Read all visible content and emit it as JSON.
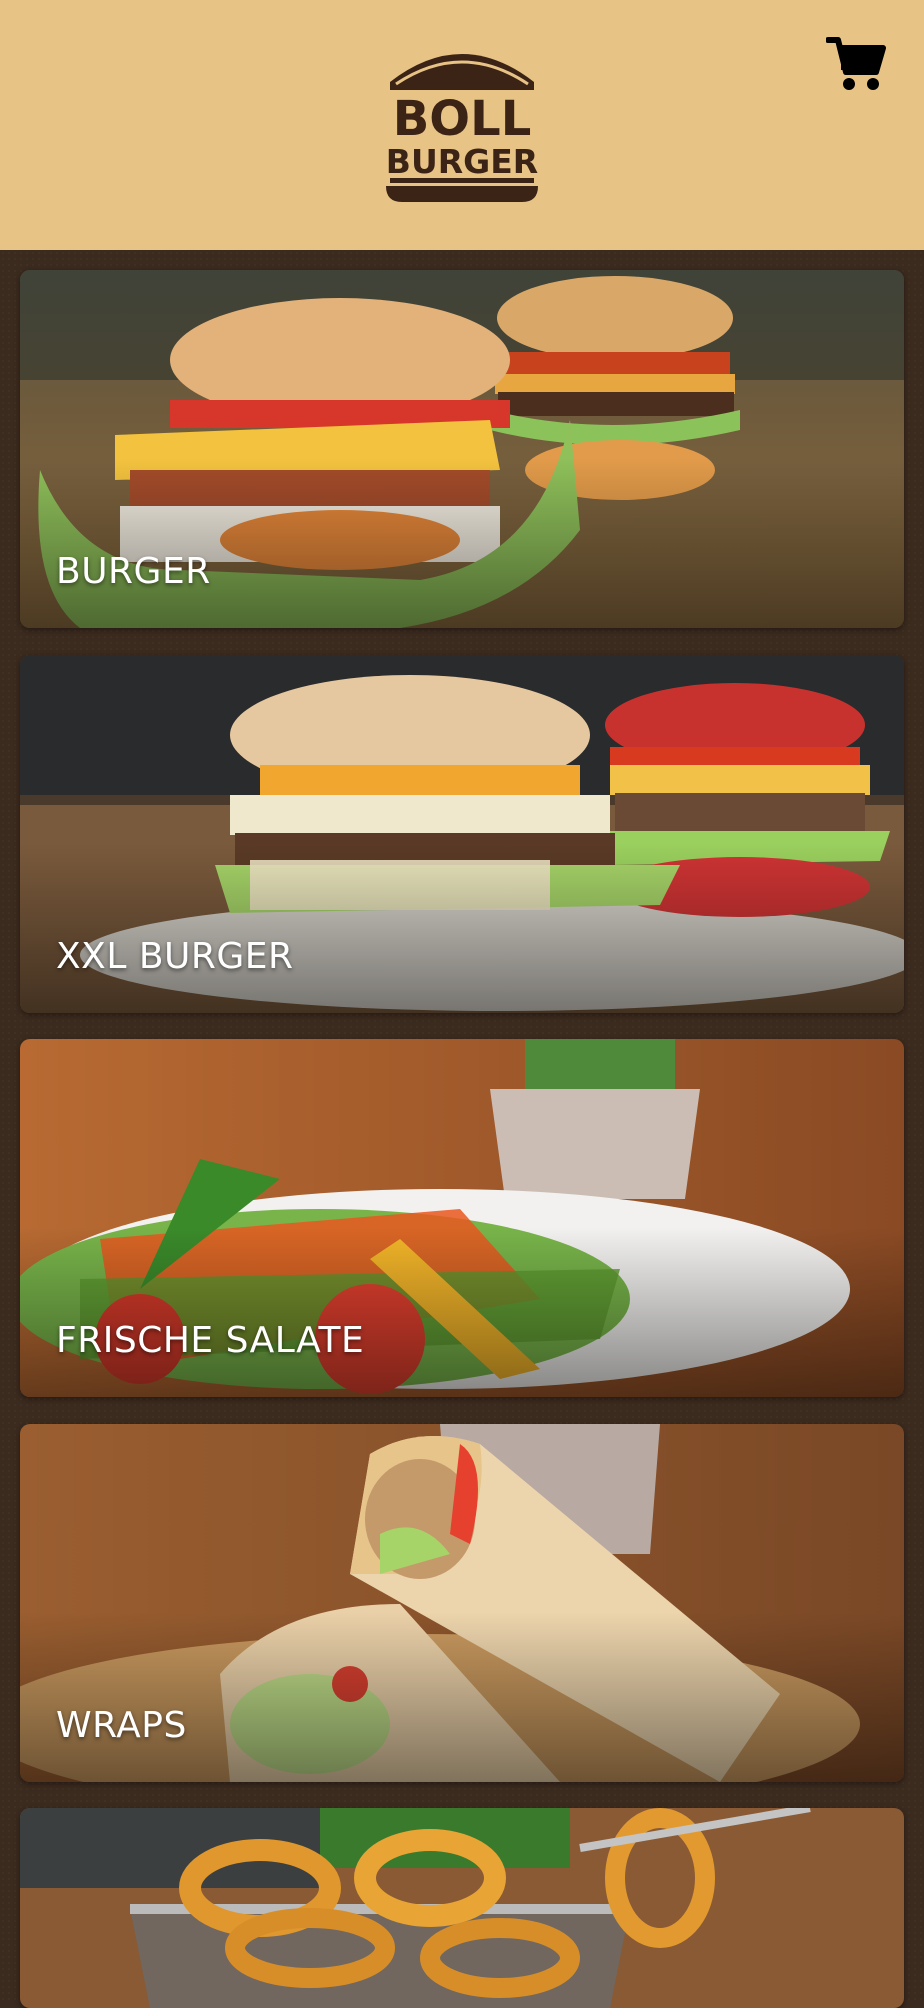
{
  "header": {
    "brand_line1": "BOLL",
    "brand_line2": "BURGER",
    "cart_icon": "shopping-cart-icon",
    "background_color": "#e8c386",
    "brand_color": "#3b2416"
  },
  "categories": [
    {
      "label": "BURGER",
      "image": "burger-photo"
    },
    {
      "label": "XXL BURGER",
      "image": "xxl-burger-photo"
    },
    {
      "label": "FRISCHE SALATE",
      "image": "salad-photo"
    },
    {
      "label": "WRAPS",
      "image": "wraps-photo"
    },
    {
      "label": "",
      "image": "onion-rings-photo"
    }
  ],
  "colors": {
    "page_background": "#3b2a1e",
    "label_text": "#ffffff"
  }
}
